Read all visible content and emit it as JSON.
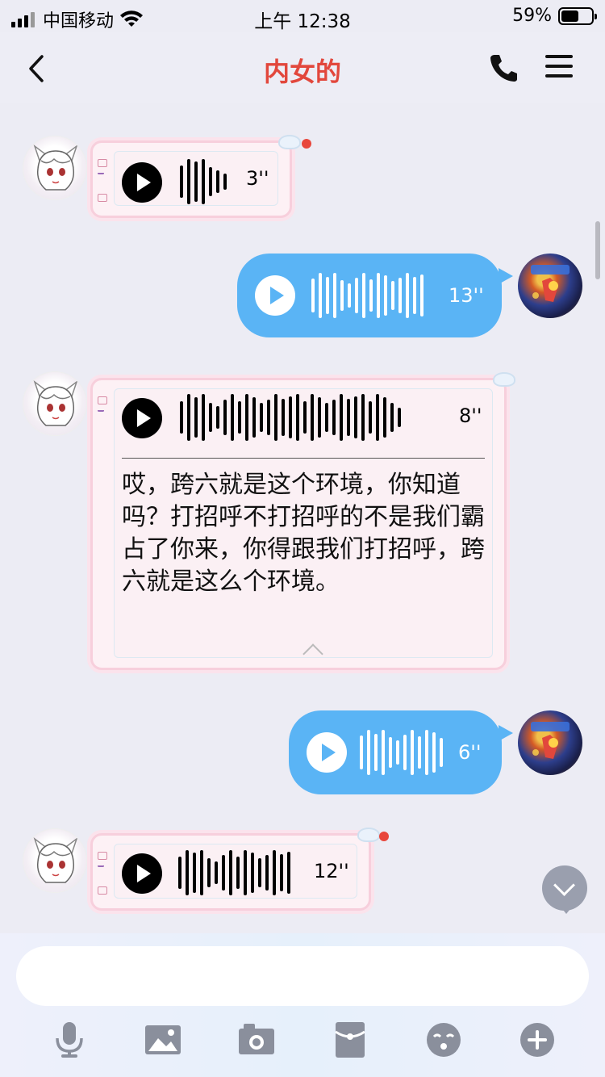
{
  "status_bar": {
    "carrier": "中国移动",
    "time": "上午 12:38",
    "battery_percent": "59%",
    "battery_level": 0.59
  },
  "nav": {
    "title": "内女的",
    "back_icon": "chevron-left-icon",
    "phone_icon": "phone-icon",
    "menu_icon": "hamburger-menu-icon"
  },
  "messages": [
    {
      "direction": "incoming",
      "type": "voice",
      "duration": "3''",
      "unread": true
    },
    {
      "direction": "outgoing",
      "type": "voice",
      "duration": "13''"
    },
    {
      "direction": "incoming",
      "type": "voice",
      "duration": "8''",
      "transcript": "哎，跨六就是这个环境，你知道吗？打招呼不打招呼的不是我们霸占了你来，你得跟我们打招呼，跨六就是这么个环境。"
    },
    {
      "direction": "outgoing",
      "type": "voice",
      "duration": "6''"
    },
    {
      "direction": "incoming",
      "type": "voice",
      "duration": "12''",
      "unread": true
    }
  ],
  "input": {
    "placeholder": ""
  },
  "toolbar": [
    "microphone-icon",
    "image-icon",
    "camera-icon",
    "red-packet-icon",
    "emoji-icon",
    "plus-icon"
  ],
  "colors": {
    "title": "#e2473c",
    "outgoing_bubble": "#5ab4f5",
    "incoming_bubble": "#fdf1f5",
    "unread_dot": "#e8473c"
  }
}
